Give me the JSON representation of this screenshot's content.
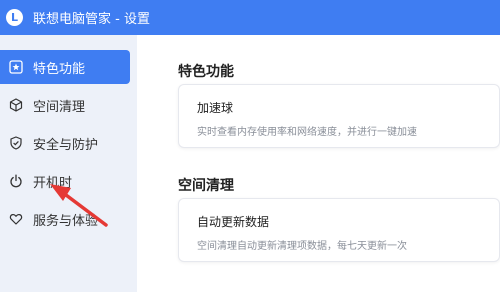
{
  "app": {
    "logo_letter": "L",
    "title": "联想电脑管家 - 设置"
  },
  "sidebar": {
    "items": [
      {
        "label": "特色功能",
        "icon": "star-icon",
        "active": true
      },
      {
        "label": "空间清理",
        "icon": "cube-icon",
        "active": false
      },
      {
        "label": "安全与防护",
        "icon": "shield-icon",
        "active": false
      },
      {
        "label": "开机时",
        "icon": "power-icon",
        "active": false
      },
      {
        "label": "服务与体验",
        "icon": "heart-icon",
        "active": false
      }
    ]
  },
  "main": {
    "sections": [
      {
        "title": "特色功能",
        "card": {
          "title": "加速球",
          "desc": "实时查看内存使用率和网络速度，并进行一键加速"
        }
      },
      {
        "title": "空间清理",
        "card": {
          "title": "自动更新数据",
          "desc": "空间清理自动更新清理项数据，每七天更新一次"
        }
      }
    ]
  },
  "colors": {
    "accent": "#3f7df2",
    "arrow": "#e53935"
  }
}
